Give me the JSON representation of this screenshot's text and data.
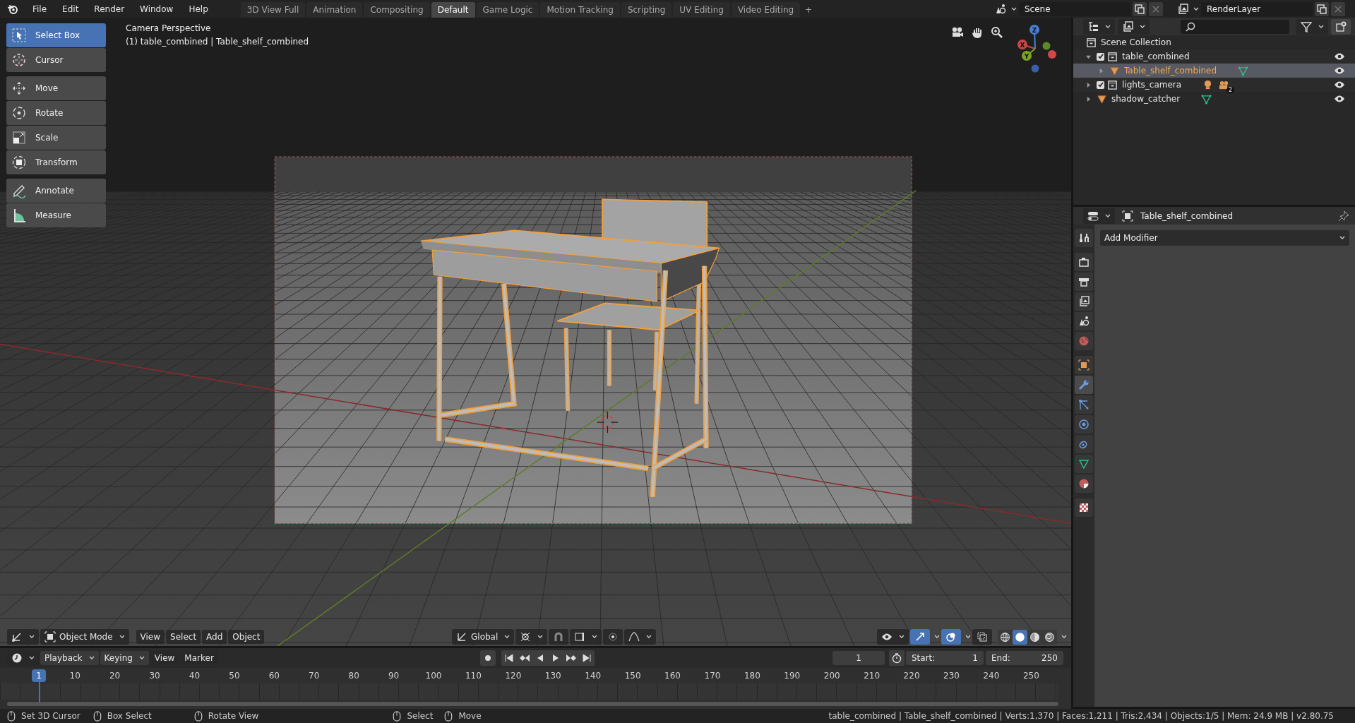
{
  "top_bar": {
    "menus": [
      "File",
      "Edit",
      "Render",
      "Window",
      "Help"
    ],
    "workspace_tabs": [
      {
        "label": "3D View Full",
        "selected": false
      },
      {
        "label": "Animation",
        "selected": false
      },
      {
        "label": "Compositing",
        "selected": false
      },
      {
        "label": "Default",
        "selected": true
      },
      {
        "label": "Game Logic",
        "selected": false
      },
      {
        "label": "Motion Tracking",
        "selected": false
      },
      {
        "label": "Scripting",
        "selected": false
      },
      {
        "label": "UV Editing",
        "selected": false
      },
      {
        "label": "Video Editing",
        "selected": false
      }
    ],
    "add_tab": "+",
    "scene": "Scene",
    "view_layer": "RenderLayer"
  },
  "toolbar": {
    "groups": [
      [
        {
          "label": "Select Box",
          "kind": "select_box",
          "selected": true
        },
        {
          "label": "Cursor",
          "kind": "cursor",
          "selected": false
        }
      ],
      [
        {
          "label": "Move",
          "kind": "move",
          "selected": false
        },
        {
          "label": "Rotate",
          "kind": "rotate",
          "selected": false
        },
        {
          "label": "Scale",
          "kind": "scale",
          "selected": false
        },
        {
          "label": "Transform",
          "kind": "transform",
          "selected": false
        }
      ],
      [
        {
          "label": "Annotate",
          "kind": "annotate",
          "selected": false
        },
        {
          "label": "Measure",
          "kind": "measure",
          "selected": false
        }
      ]
    ]
  },
  "viewport": {
    "view_name": "Camera Perspective",
    "object_info": "(1) table_combined | Table_shelf_combined",
    "gizmo_axes": [
      "X",
      "Y",
      "Z"
    ]
  },
  "viewport_header": {
    "mode": "Object Mode",
    "menus": [
      "View",
      "Select",
      "Add",
      "Object"
    ],
    "orientation": "Global",
    "shading_modes": [
      {
        "kind": "wireframe",
        "selected": false
      },
      {
        "kind": "solid",
        "selected": true
      },
      {
        "kind": "material",
        "selected": false
      },
      {
        "kind": "rendered",
        "selected": false
      }
    ]
  },
  "outliner": {
    "root": "Scene Collection",
    "items": [
      {
        "label": "table_combined",
        "kind": "collection",
        "checked": true,
        "expanded": true,
        "selected": false,
        "children": [
          {
            "label": "Table_shelf_combined",
            "kind": "mesh",
            "expanded": false,
            "selected": true
          }
        ]
      },
      {
        "label": "lights_camera",
        "kind": "collection",
        "checked": true,
        "expanded": false,
        "selected": false,
        "badge": "2"
      },
      {
        "label": "shadow_catcher",
        "kind": "mesh",
        "expanded": false,
        "selected": false
      }
    ]
  },
  "properties": {
    "object_name": "Table_shelf_combined",
    "modifier_menu": "Add Modifier",
    "tab_groups": [
      [
        {
          "kind": "tool",
          "selected": false
        }
      ],
      [
        {
          "kind": "render",
          "selected": false
        },
        {
          "kind": "output",
          "selected": false
        },
        {
          "kind": "view_layer",
          "selected": false
        },
        {
          "kind": "scene",
          "selected": false
        },
        {
          "kind": "world",
          "selected": false
        }
      ],
      [
        {
          "kind": "object",
          "selected": false
        },
        {
          "kind": "modifier",
          "selected": true
        },
        {
          "kind": "particles",
          "selected": false
        },
        {
          "kind": "physics",
          "selected": false
        },
        {
          "kind": "constraints",
          "selected": false
        },
        {
          "kind": "data",
          "selected": false
        },
        {
          "kind": "material",
          "selected": false
        }
      ],
      [
        {
          "kind": "texture",
          "selected": false
        }
      ]
    ]
  },
  "timeline": {
    "menus": [
      {
        "label": "Playback",
        "dropdown": true
      },
      {
        "label": "Keying",
        "dropdown": true
      },
      {
        "label": "View",
        "dropdown": false
      },
      {
        "label": "Marker",
        "dropdown": false
      }
    ],
    "current_frame": "1",
    "frame_field": "1",
    "start_label": "Start:",
    "start": "1",
    "end_label": "End:",
    "end": "250",
    "ruler_labels": [
      "10",
      "20",
      "30",
      "40",
      "50",
      "60",
      "70",
      "80",
      "90",
      "100",
      "110",
      "120",
      "130",
      "140",
      "150",
      "160",
      "170",
      "180",
      "190",
      "200",
      "210",
      "220",
      "230",
      "240",
      "250"
    ]
  },
  "status_bar": {
    "hints": [
      "Set 3D Cursor",
      "Box Select",
      "Rotate View",
      "Select",
      "Move"
    ],
    "stats": "table_combined | Table_shelf_combined | Verts:1,370 | Faces:1,211 | Tris:2,434 | Objects:1/5 | Mem: 24.9 MB | v2.80.75"
  }
}
